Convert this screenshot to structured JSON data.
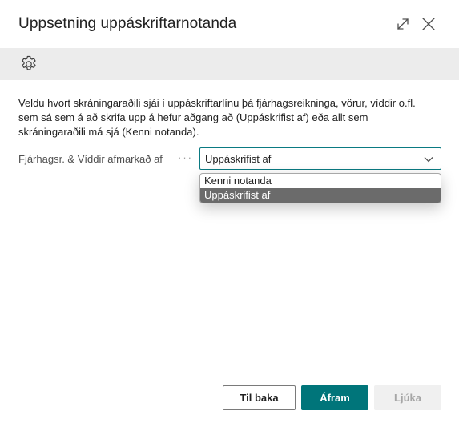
{
  "dialog": {
    "title": "Uppsetning uppáskriftarnotanda",
    "expand_icon": "expand-arrows-icon",
    "close_icon": "close-icon"
  },
  "toolbar": {
    "settings_icon": "gear-icon"
  },
  "content": {
    "instructions": "Veldu hvort skráningaraðili sjái í uppáskriftarlínu þá fjárhagsreikninga, vörur, víddir o.fl. sem sá sem á að skrifa upp á hefur aðgang að (Uppáskrifist af) eða allt sem skráningaraðili má sjá (Kenni notanda).",
    "field": {
      "label": "Fjárhagsr. & Víddir afmarkað af",
      "value": "Uppáskrifist af",
      "options": [
        "Kenni notanda",
        "Uppáskrifist af"
      ],
      "selected_index": 1
    }
  },
  "footer": {
    "back_label": "Til baka",
    "next_label": "Áfram",
    "finish_label": "Ljúka"
  },
  "colors": {
    "accent": "#00757a",
    "focus_border": "#0a7a82",
    "toolbar_bg": "#ececec",
    "selected_option": "#6b6b6b"
  }
}
